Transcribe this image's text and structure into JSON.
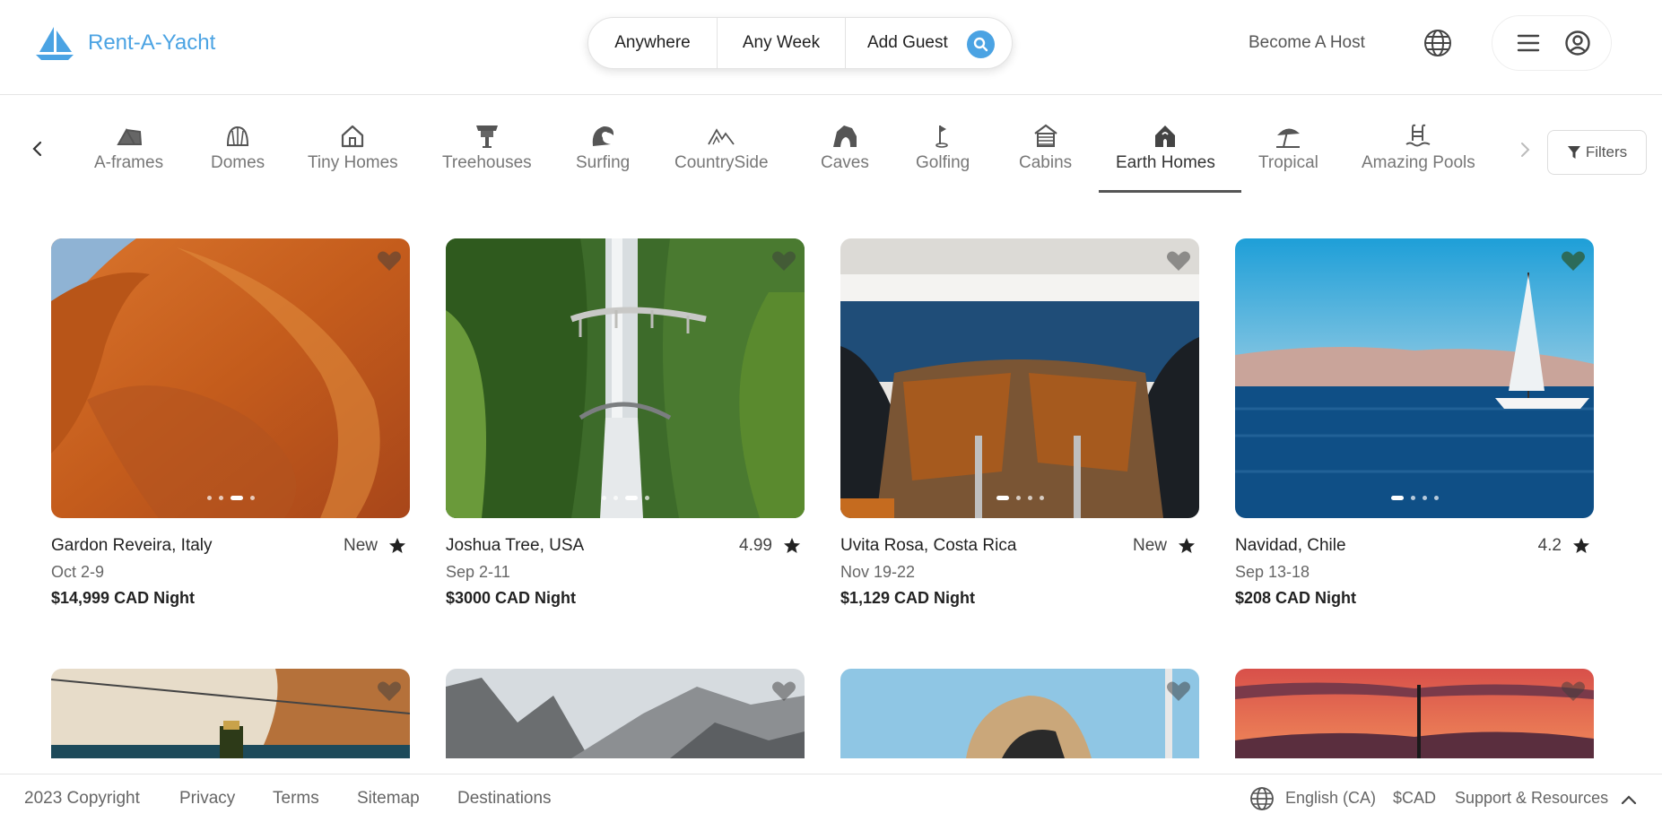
{
  "header": {
    "brand": "Rent-A-Yacht",
    "search": {
      "where": "Anywhere",
      "when": "Any Week",
      "guests": "Add Guest"
    },
    "become_host": "Become A Host"
  },
  "categories": {
    "items": [
      {
        "label": "A-frames",
        "icon": "a-frame-icon"
      },
      {
        "label": "Domes",
        "icon": "dome-icon"
      },
      {
        "label": "Tiny Homes",
        "icon": "tiny-home-icon"
      },
      {
        "label": "Treehouses",
        "icon": "treehouse-icon"
      },
      {
        "label": "Surfing",
        "icon": "surfing-icon"
      },
      {
        "label": "CountrySide",
        "icon": "countryside-icon"
      },
      {
        "label": "Caves",
        "icon": "cave-icon"
      },
      {
        "label": "Golfing",
        "icon": "golf-icon"
      },
      {
        "label": "Cabins",
        "icon": "cabin-icon"
      },
      {
        "label": "Earth Homes",
        "icon": "earth-home-icon"
      },
      {
        "label": "Tropical",
        "icon": "tropical-icon"
      },
      {
        "label": "Amazing Pools",
        "icon": "pool-icon"
      }
    ],
    "active": "Earth Homes",
    "filters_label": "Filters"
  },
  "listings": [
    {
      "location": "Gardon Reveira, Italy",
      "rating": "New",
      "dates": "Oct 2-9",
      "price": "$14,999 CAD Night",
      "active_slide": 3,
      "slides": 4
    },
    {
      "location": "Joshua Tree, USA",
      "rating": "4.99",
      "dates": "Sep 2-11",
      "price": "$3000 CAD Night",
      "active_slide": 3,
      "slides": 4
    },
    {
      "location": "Uvita Rosa, Costa Rica",
      "rating": "New",
      "dates": "Nov 19-22",
      "price": "$1,129 CAD Night",
      "active_slide": 1,
      "slides": 4
    },
    {
      "location": "Navidad, Chile",
      "rating": "4.2",
      "dates": "Sep 13-18",
      "price": "$208 CAD Night",
      "active_slide": 1,
      "slides": 4
    }
  ],
  "footer": {
    "copyright": "2023 Copyright",
    "links": [
      "Privacy",
      "Terms",
      "Sitemap",
      "Destinations"
    ],
    "language": "English (CA)",
    "currency": "$CAD",
    "support": "Support & Resources"
  },
  "colors": {
    "brand": "#4ba3e3",
    "text": "#222222",
    "muted": "#777777"
  }
}
